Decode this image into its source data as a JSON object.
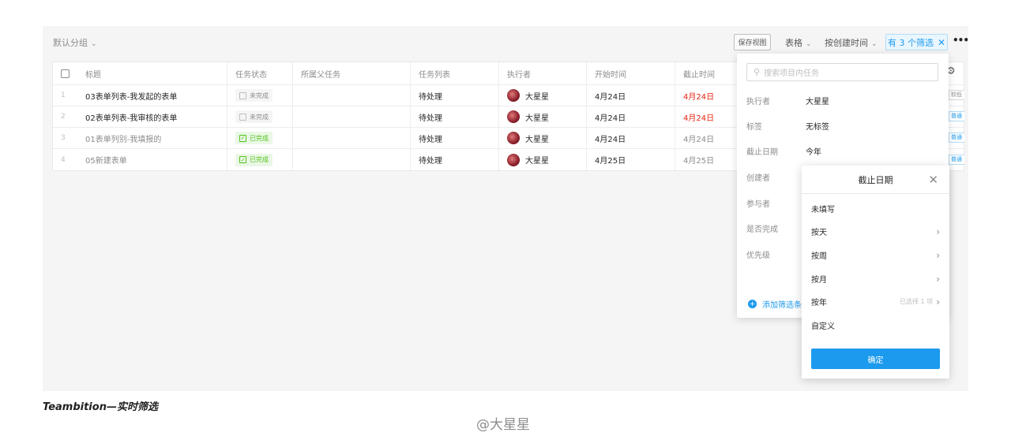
{
  "group": {
    "label": "默认分组"
  },
  "toolbar": {
    "save_view": "保存视图",
    "view_type": "表格",
    "sort": "按创建时间",
    "filter_badge": "有 3 个筛选"
  },
  "table": {
    "columns": [
      "标题",
      "任务状态",
      "所属父任务",
      "任务列表",
      "执行者",
      "开始时间",
      "截止时间"
    ],
    "rows": [
      {
        "index": "1",
        "title": "03表单列表-我发起的表单",
        "status": "未完成",
        "done": false,
        "parent": "",
        "list": "待处理",
        "assignee": "大星星",
        "start": "4月24日",
        "due": "4月24日",
        "due_overdue": true,
        "tag": "较低"
      },
      {
        "index": "2",
        "title": "02表单列表-我审核的表单",
        "status": "未完成",
        "done": false,
        "parent": "",
        "list": "待处理",
        "assignee": "大星星",
        "start": "4月24日",
        "due": "4月24日",
        "due_overdue": true,
        "tag": "普通"
      },
      {
        "index": "3",
        "title": "01表单列别-我填报的",
        "status": "已完成",
        "done": true,
        "parent": "",
        "list": "待处理",
        "assignee": "大星星",
        "start": "4月24日",
        "due": "4月24日",
        "due_overdue": false,
        "tag": "普通"
      },
      {
        "index": "4",
        "title": "05新建表单",
        "status": "已完成",
        "done": true,
        "parent": "",
        "list": "待处理",
        "assignee": "大星星",
        "start": "4月25日",
        "due": "4月25日",
        "due_overdue": false,
        "tag": "普通"
      }
    ]
  },
  "filter_panel": {
    "search_placeholder": "搜索项目内任务",
    "fields": [
      {
        "label": "执行者",
        "value": "大星星"
      },
      {
        "label": "标签",
        "value": "无标签"
      },
      {
        "label": "截止日期",
        "value": "今年"
      },
      {
        "label": "创建者",
        "value": ""
      },
      {
        "label": "参与者",
        "value": ""
      },
      {
        "label": "是否完成",
        "value": ""
      },
      {
        "label": "优先级",
        "value": ""
      }
    ],
    "add_filter": "添加筛选条"
  },
  "date_panel": {
    "title": "截止日期",
    "options": [
      {
        "label": "未填写",
        "arrow": false,
        "note": ""
      },
      {
        "label": "按天",
        "arrow": true,
        "note": ""
      },
      {
        "label": "按周",
        "arrow": true,
        "note": ""
      },
      {
        "label": "按月",
        "arrow": true,
        "note": ""
      },
      {
        "label": "按年",
        "arrow": true,
        "note": "已选择 1 项"
      },
      {
        "label": "自定义",
        "arrow": false,
        "note": ""
      }
    ],
    "confirm": "确定"
  },
  "caption": "Teambition—实时筛选",
  "watermark": "@大星星",
  "colors": {
    "accent": "#1b9aee",
    "overdue": "#e62412",
    "done": "#52c41a"
  }
}
